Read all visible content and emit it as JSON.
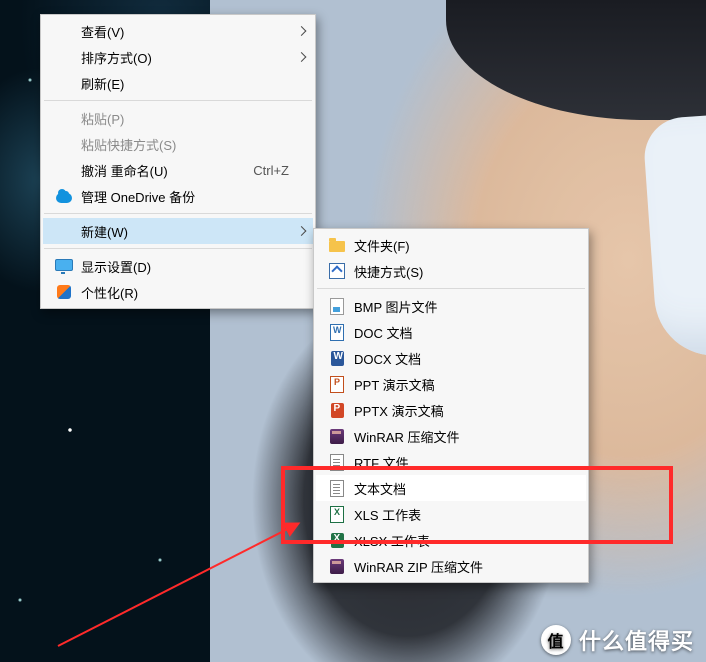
{
  "menu1": {
    "view": "查看(V)",
    "sort": "排序方式(O)",
    "refresh": "刷新(E)",
    "paste": "粘贴(P)",
    "paste_shortcut": "粘贴快捷方式(S)",
    "undo": "撤消 重命名(U)",
    "undo_key": "Ctrl+Z",
    "onedrive": "管理 OneDrive 备份",
    "new": "新建(W)",
    "display": "显示设置(D)",
    "personalize": "个性化(R)"
  },
  "menu2": {
    "folder": "文件夹(F)",
    "shortcut": "快捷方式(S)",
    "bmp": "BMP 图片文件",
    "doc": "DOC 文档",
    "docx": "DOCX 文档",
    "ppt": "PPT 演示文稿",
    "pptx": "PPTX 演示文稿",
    "rar": "WinRAR 压缩文件",
    "rtf": "RTF 文件",
    "txt": "文本文档",
    "xls": "XLS 工作表",
    "xlsx": "XLSX 工作表",
    "zip": "WinRAR ZIP 压缩文件"
  },
  "watermark": {
    "badge": "值",
    "text": "什么值得买"
  }
}
